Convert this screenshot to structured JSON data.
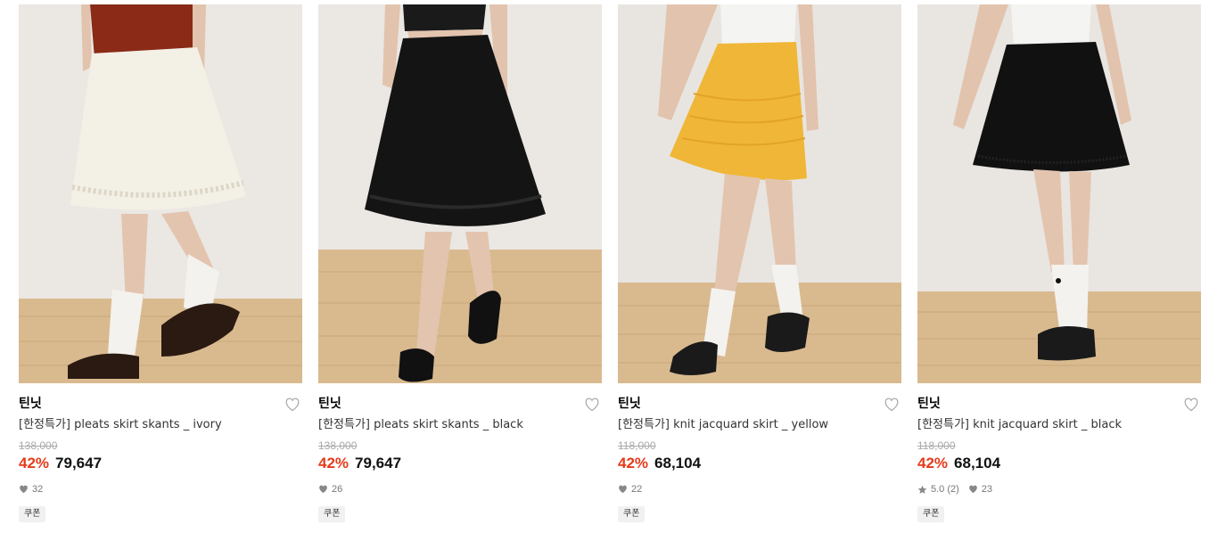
{
  "products": [
    {
      "brand": "틴닛",
      "name": "[한정특가] pleats skirt skants _ ivory",
      "original_price": "138,000",
      "discount": "42%",
      "price": "79,647",
      "likes": "32",
      "rating": "",
      "badge": "쿠폰",
      "skirt_color": "#f3f0e6",
      "top_color": "#8a2a17"
    },
    {
      "brand": "틴닛",
      "name": "[한정특가] pleats skirt skants _ black",
      "original_price": "138,000",
      "discount": "42%",
      "price": "79,647",
      "likes": "26",
      "rating": "",
      "badge": "쿠폰",
      "skirt_color": "#141414",
      "top_color": "#1a1a1a"
    },
    {
      "brand": "틴닛",
      "name": "[한정특가] knit jacquard skirt _ yellow",
      "original_price": "118,000",
      "discount": "42%",
      "price": "68,104",
      "likes": "22",
      "rating": "",
      "badge": "쿠폰",
      "skirt_color": "#f0b637",
      "top_color": "#f4f4f2"
    },
    {
      "brand": "틴닛",
      "name": "[한정특가] knit jacquard skirt _ black",
      "original_price": "118,000",
      "discount": "42%",
      "price": "68,104",
      "likes": "23",
      "rating": "5.0 (2)",
      "badge": "쿠폰",
      "skirt_color": "#111111",
      "top_color": "#f4f4f2"
    }
  ],
  "colors": {
    "discount": "#e63a1a",
    "wall": "#e9e5e1",
    "floor": "#d8b98e"
  }
}
